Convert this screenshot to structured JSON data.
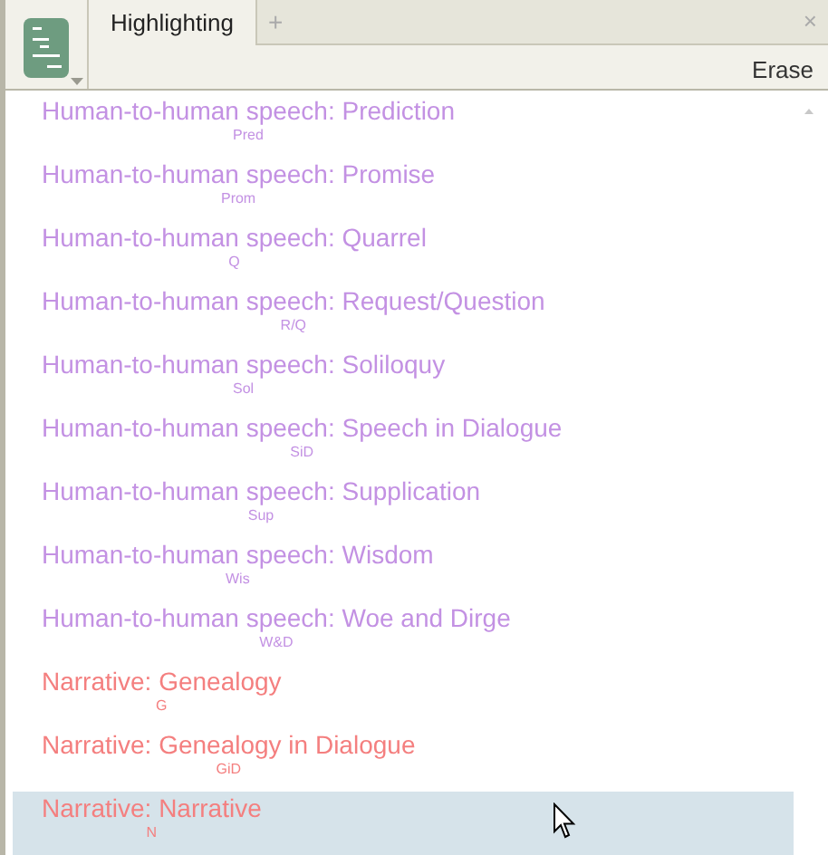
{
  "tabs": [
    {
      "label": "Highlighting",
      "selected": true
    }
  ],
  "new_tab": "+",
  "close": "×",
  "toolbar": {
    "erase": "Erase"
  },
  "items": [
    {
      "label": "Human-to-human speech: Prediction",
      "abbr": "Pred",
      "color": "#c391e3",
      "selected": false
    },
    {
      "label": "Human-to-human speech: Promise",
      "abbr": "Prom",
      "color": "#c391e3",
      "selected": false
    },
    {
      "label": "Human-to-human speech: Quarrel",
      "abbr": "Q",
      "color": "#c391e3",
      "selected": false
    },
    {
      "label": "Human-to-human speech: Request/Question",
      "abbr": "R/Q",
      "color": "#c391e3",
      "selected": false
    },
    {
      "label": "Human-to-human speech: Soliloquy",
      "abbr": "Sol",
      "color": "#c391e3",
      "selected": false
    },
    {
      "label": "Human-to-human speech: Speech in Dialogue",
      "abbr": "SiD",
      "color": "#c391e3",
      "selected": false
    },
    {
      "label": "Human-to-human speech: Supplication",
      "abbr": "Sup",
      "color": "#c391e3",
      "selected": false
    },
    {
      "label": "Human-to-human speech: Wisdom",
      "abbr": "Wis",
      "color": "#c391e3",
      "selected": false
    },
    {
      "label": "Human-to-human speech: Woe and Dirge",
      "abbr": "W&D",
      "color": "#c391e3",
      "selected": false
    },
    {
      "label": "Narrative: Genealogy",
      "abbr": "G",
      "color": "#f47f7f",
      "selected": false
    },
    {
      "label": "Narrative: Genealogy in Dialogue",
      "abbr": "GiD",
      "color": "#f47f7f",
      "selected": false
    },
    {
      "label": "Narrative: Narrative",
      "abbr": "N",
      "color": "#f47f7f",
      "selected": true
    }
  ]
}
